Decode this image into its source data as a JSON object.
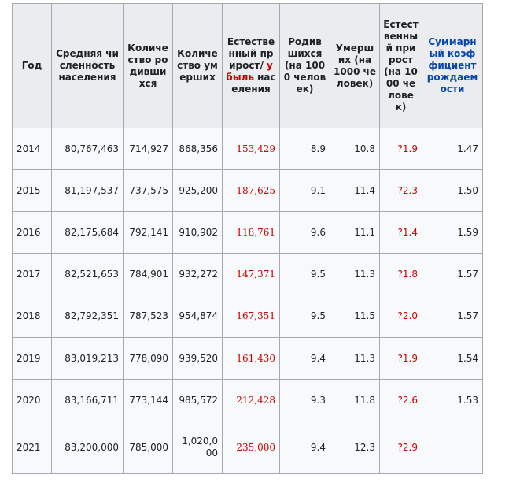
{
  "headers": {
    "year": "Год",
    "population": "Средняя численность населения",
    "births": "Количество родившихся",
    "deaths": "Количество умерших",
    "growth_pre": "Естественный прирост/",
    "growth_red": "убыль",
    "growth_post": " населения",
    "birth_rate": "Родившихся (на 1000 человек)",
    "death_rate": "Умерших (на 1000 человек)",
    "natural_rate": "Естественный прирост (на 1000 человек)",
    "fertility": "Суммарный коэффициент рождаемости"
  },
  "rows": [
    {
      "year": "2014",
      "population": "80,767,463",
      "births": "714,927",
      "deaths": "868,356",
      "growth": "153,429",
      "birth_rate": "8.9",
      "death_rate": "10.8",
      "natural_rate": "?1.9",
      "fertility": "1.47"
    },
    {
      "year": "2015",
      "population": "81,197,537",
      "births": "737,575",
      "deaths": "925,200",
      "growth": "187,625",
      "birth_rate": "9.1",
      "death_rate": "11.4",
      "natural_rate": "?2.3",
      "fertility": "1.50"
    },
    {
      "year": "2016",
      "population": "82,175,684",
      "births": "792,141",
      "deaths": "910,902",
      "growth": "118,761",
      "birth_rate": "9.6",
      "death_rate": "11.1",
      "natural_rate": "?1.4",
      "fertility": "1.59"
    },
    {
      "year": "2017",
      "population": "82,521,653",
      "births": "784,901",
      "deaths": "932,272",
      "growth": "147,371",
      "birth_rate": "9.5",
      "death_rate": "11.3",
      "natural_rate": "?1.8",
      "fertility": "1.57"
    },
    {
      "year": "2018",
      "population": "82,792,351",
      "births": "787,523",
      "deaths": "954,874",
      "growth": "167,351",
      "birth_rate": "9.5",
      "death_rate": "11.5",
      "natural_rate": "?2.0",
      "fertility": "1.57"
    },
    {
      "year": "2019",
      "population": "83,019,213",
      "births": "778,090",
      "deaths": "939,520",
      "growth": "161,430",
      "birth_rate": "9.4",
      "death_rate": "11.3",
      "natural_rate": "?1.9",
      "fertility": "1.54"
    },
    {
      "year": "2020",
      "population": "83,166,711",
      "births": "773,144",
      "deaths": "985,572",
      "growth": "212,428",
      "birth_rate": "9.3",
      "death_rate": "11.8",
      "natural_rate": "?2.6",
      "fertility": "1.53"
    },
    {
      "year": "2021",
      "population": "83,200,000",
      "births": "785,000",
      "deaths": "1,020,000",
      "growth": "235,000",
      "birth_rate": "9.4",
      "death_rate": "12.3",
      "natural_rate": "?2.9",
      "fertility": ""
    }
  ],
  "colors": {
    "decrease_red": "#cc0000",
    "link_blue": "#0645ad",
    "header_bg": "#eaecf0",
    "border": "#a2a9b1"
  }
}
